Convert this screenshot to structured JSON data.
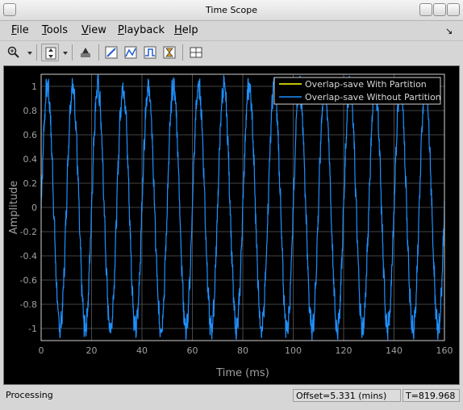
{
  "window": {
    "title": "Time Scope"
  },
  "menu": [
    {
      "label": "File",
      "accel": "F",
      "rest": "ile"
    },
    {
      "label": "Tools",
      "accel": "T",
      "rest": "ools"
    },
    {
      "label": "View",
      "accel": "V",
      "rest": "iew"
    },
    {
      "label": "Playback",
      "accel": "P",
      "rest": "layback"
    },
    {
      "label": "Help",
      "accel": "H",
      "rest": "elp"
    }
  ],
  "toolbar": {
    "icons": [
      "zoom-in-icon",
      "scale-axes-icon",
      "run-icon",
      "signal-statistics-icon",
      "peak-finder-icon",
      "bilevel-measurements-icon",
      "triggers-icon",
      "layout-icon"
    ]
  },
  "chart_data": {
    "type": "line",
    "xlabel": "Time (ms)",
    "ylabel": "Amplitude",
    "xlim": [
      0,
      160
    ],
    "ylim": [
      -1.1,
      1.1
    ],
    "xticks": [
      0,
      20,
      40,
      60,
      80,
      100,
      120,
      140,
      160
    ],
    "yticks": [
      -1,
      -0.8,
      -0.6,
      -0.4,
      -0.2,
      0,
      0.2,
      0.4,
      0.6,
      0.8,
      1
    ],
    "ytick_labels": [
      "-1",
      "-0.8",
      "-0.6",
      "-0.4",
      "-0.2",
      "0",
      "0.2",
      "0.4",
      "0.6",
      "0.8",
      "1"
    ],
    "grid": true,
    "legend_position": "top-right",
    "background": "#000000",
    "series": [
      {
        "name": "Overlap-save With Partition",
        "color": "#ffff00",
        "visible_in_plot": false
      },
      {
        "name": "Overlap-save Without Partition",
        "color": "#1e90ff",
        "frequency_khz": 0.1,
        "amplitude": 1.0,
        "noise": 0.1
      }
    ]
  },
  "status": {
    "state": "Processing",
    "offset": "Offset=5.331 (mins)",
    "time": "T=819.968"
  }
}
